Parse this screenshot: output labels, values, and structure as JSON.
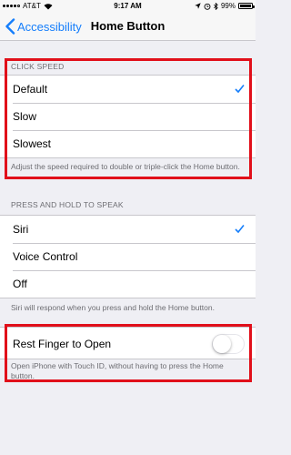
{
  "status_bar": {
    "carrier": "AT&T",
    "time": "9:17 AM",
    "battery_percent": "99%"
  },
  "nav": {
    "back_label": "Accessibility",
    "title": "Home Button"
  },
  "click_speed": {
    "header": "CLICK SPEED",
    "options": [
      "Default",
      "Slow",
      "Slowest"
    ],
    "selected": "Default",
    "footer": "Adjust the speed required to double or triple-click the Home button."
  },
  "press_hold": {
    "header": "PRESS AND HOLD TO SPEAK",
    "options": [
      "Siri",
      "Voice Control",
      "Off"
    ],
    "selected": "Siri",
    "footer": "Siri will respond when you press and hold the Home button."
  },
  "rest_finger": {
    "label": "Rest Finger to Open",
    "enabled": false,
    "footer": "Open iPhone with Touch ID, without having to press the Home button."
  },
  "colors": {
    "accent": "#157efb",
    "highlight": "#e10f1a",
    "background": "#efeff4"
  }
}
